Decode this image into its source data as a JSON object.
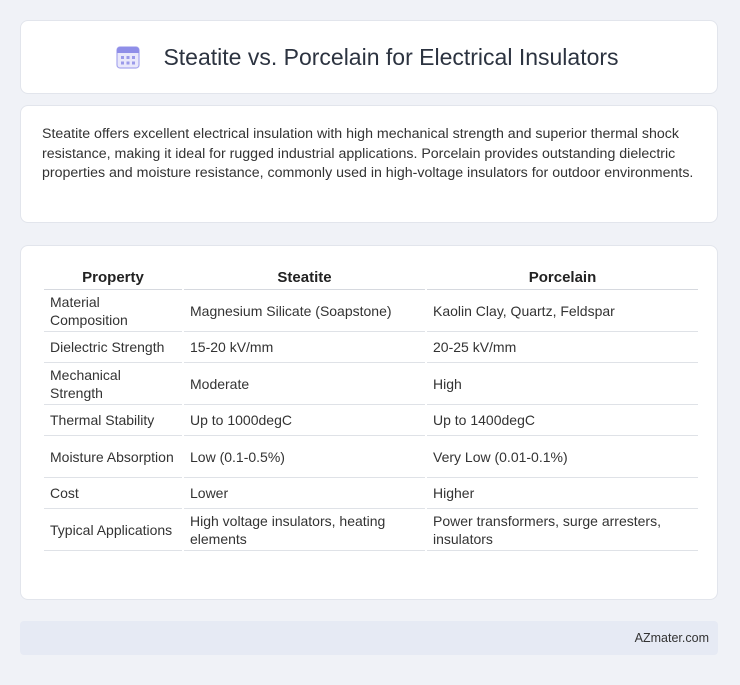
{
  "header": {
    "title": "Steatite vs. Porcelain for Electrical Insulators",
    "icon": "calendar-icon"
  },
  "summary": {
    "text": "Steatite offers excellent electrical insulation with high mechanical strength and superior thermal shock resistance, making it ideal for rugged industrial applications. Porcelain provides outstanding dielectric properties and moisture resistance, commonly used in high-voltage insulators for outdoor environments."
  },
  "table": {
    "headers": [
      "Property",
      "Steatite",
      "Porcelain"
    ],
    "rows": [
      [
        "Material Composition",
        "Magnesium Silicate (Soapstone)",
        "Kaolin Clay, Quartz, Feldspar"
      ],
      [
        "Dielectric Strength",
        "15-20 kV/mm",
        "20-25 kV/mm"
      ],
      [
        "Mechanical Strength",
        "Moderate",
        "High"
      ],
      [
        "Thermal Stability",
        "Up to 1000degC",
        "Up to 1400degC"
      ],
      [
        "Moisture Absorption",
        "Low (0.1-0.5%)",
        "Very Low (0.01-0.1%)"
      ],
      [
        "Cost",
        "Lower",
        "Higher"
      ],
      [
        "Typical Applications",
        "High voltage insulators, heating elements",
        "Power transformers, surge arresters, insulators"
      ]
    ]
  },
  "footer": {
    "brand": "AZmater.com"
  },
  "colors": {
    "background": "#f0f2f7",
    "card": "#ffffff",
    "footer": "#e6eaf4",
    "icon_accent": "#8f8ee8"
  }
}
